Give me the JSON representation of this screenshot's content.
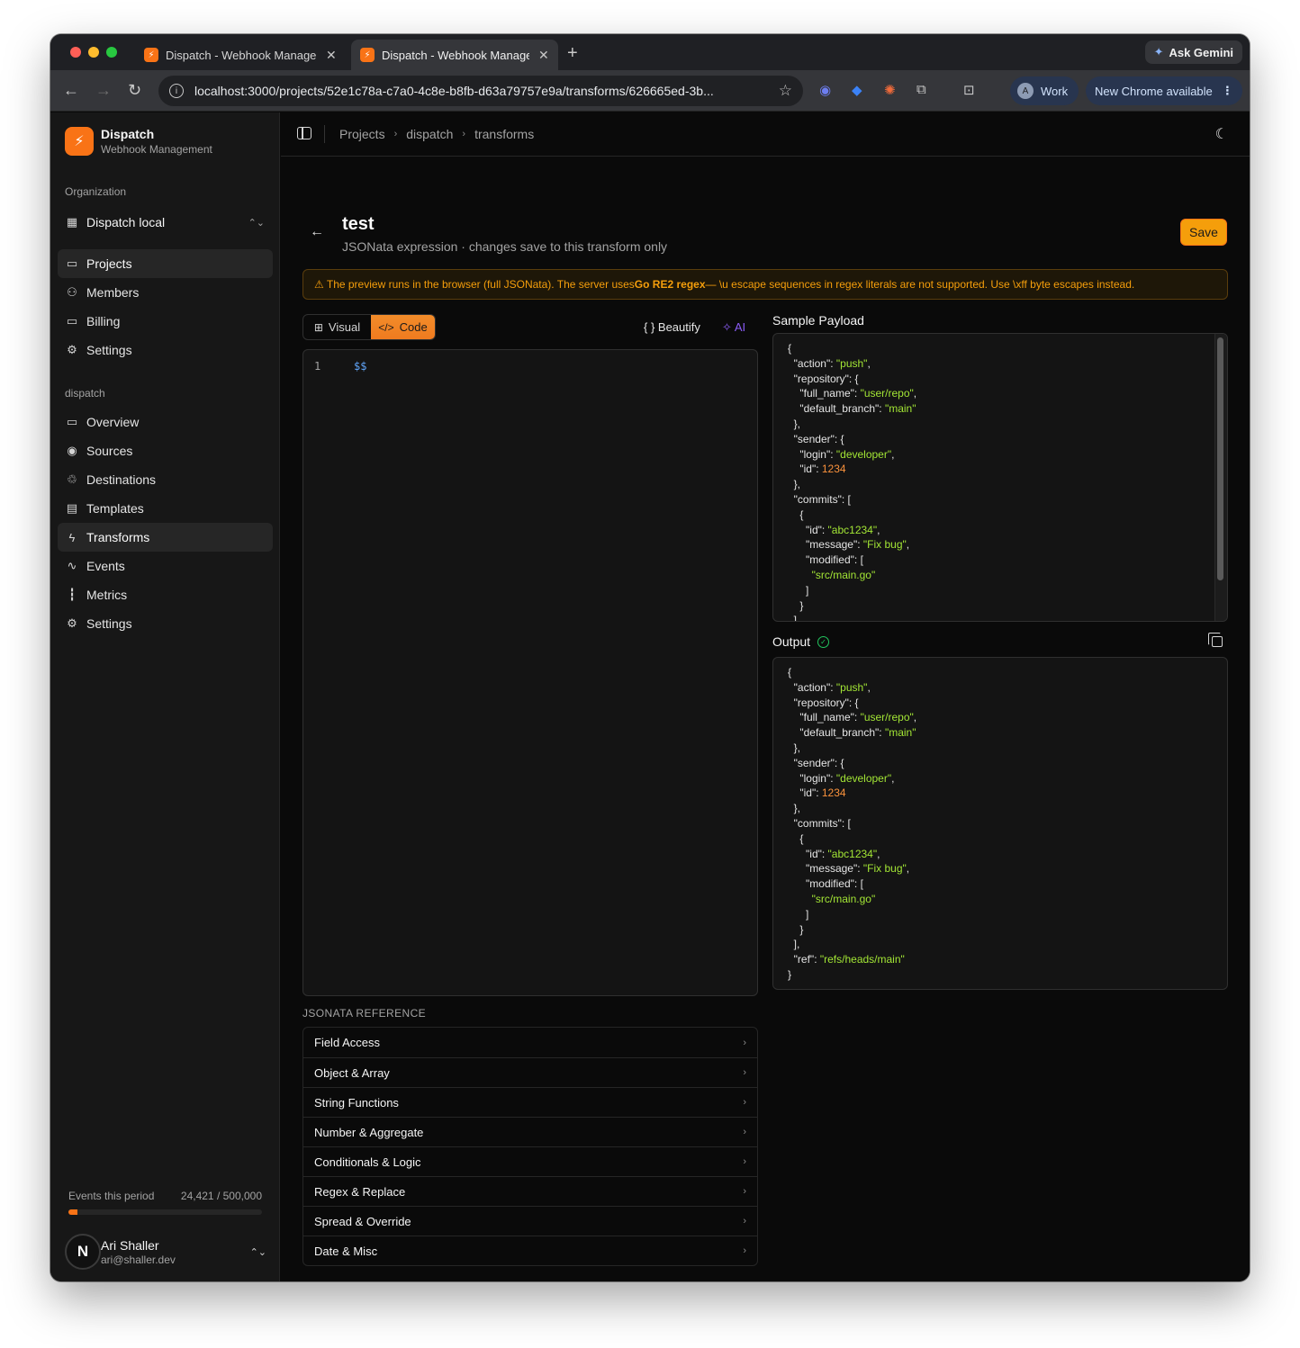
{
  "browser": {
    "tabs": [
      {
        "title": "Dispatch - Webhook Management",
        "active": false
      },
      {
        "title": "Dispatch - Webhook Management",
        "active": true
      }
    ],
    "ask_gemini": "Ask Gemini",
    "url": "localhost:3000/projects/52e1c78a-c7a0-4c8e-b8fb-d63a79757e9a/transforms/626665ed-3b...",
    "profile_label": "Work",
    "profile_initial": "A",
    "update_label": "New Chrome available"
  },
  "sidebar": {
    "brand_name": "Dispatch",
    "brand_sub": "Webhook Management",
    "org_label": "Organization",
    "org_name": "Dispatch local",
    "org_items": [
      {
        "label": "Projects",
        "icon": "folder-icon",
        "active": true
      },
      {
        "label": "Members",
        "icon": "users-icon",
        "active": false
      },
      {
        "label": "Billing",
        "icon": "credit-card-icon",
        "active": false
      },
      {
        "label": "Settings",
        "icon": "gear-icon",
        "active": false
      }
    ],
    "project_label": "dispatch",
    "project_items": [
      {
        "label": "Overview",
        "icon": "folder-open-icon",
        "active": false
      },
      {
        "label": "Sources",
        "icon": "broadcast-icon",
        "active": false
      },
      {
        "label": "Destinations",
        "icon": "webhook-icon",
        "active": false
      },
      {
        "label": "Templates",
        "icon": "file-text-icon",
        "active": false
      },
      {
        "label": "Transforms",
        "icon": "bolt-icon",
        "active": true
      },
      {
        "label": "Events",
        "icon": "activity-icon",
        "active": false
      },
      {
        "label": "Metrics",
        "icon": "bar-chart-icon",
        "active": false
      },
      {
        "label": "Settings",
        "icon": "gear-icon",
        "active": false
      }
    ],
    "usage_label": "Events this period",
    "usage_value": "24,421 / 500,000",
    "usage_fraction": 0.0488,
    "user_initial": "N",
    "user_name": "Ari Shaller",
    "user_email": "ari@shaller.dev"
  },
  "header": {
    "breadcrumbs": [
      "Projects",
      "dispatch",
      "transforms"
    ]
  },
  "page": {
    "title": "test",
    "subtitle": "JSONata expression · changes save to this transform only",
    "save_label": "Save",
    "warning_prefix": "⚠ The preview runs in the browser (full JSONata). The server uses ",
    "warning_bold": "Go RE2 regex",
    "warning_suffix": " — \\u escape sequences in regex literals are not supported. Use \\xff byte escapes instead.",
    "mode_visual": "Visual",
    "mode_code": "Code",
    "beautify_label": "{ } Beautify",
    "ai_label": "AI",
    "line_number": "1",
    "code": "$$",
    "reference_label": "JSONATA REFERENCE",
    "reference_items": [
      "Field Access",
      "Object & Array",
      "String Functions",
      "Number & Aggregate",
      "Conditionals & Logic",
      "Regex & Replace",
      "Spread & Override",
      "Date & Misc"
    ],
    "sample_label": "Sample Payload",
    "sample_json": "{\n  \"action\": \"push\",\n  \"repository\": {\n    \"full_name\": \"user/repo\",\n    \"default_branch\": \"main\"\n  },\n  \"sender\": {\n    \"login\": \"developer\",\n    \"id\": 1234\n  },\n  \"commits\": [\n    {\n      \"id\": \"abc1234\",\n      \"message\": \"Fix bug\",\n      \"modified\": [\n        \"src/main.go\"\n      ]\n    }\n  ]",
    "output_label": "Output",
    "output_json": "{\n  \"action\": \"push\",\n  \"repository\": {\n    \"full_name\": \"user/repo\",\n    \"default_branch\": \"main\"\n  },\n  \"sender\": {\n    \"login\": \"developer\",\n    \"id\": 1234\n  },\n  \"commits\": [\n    {\n      \"id\": \"abc1234\",\n      \"message\": \"Fix bug\",\n      \"modified\": [\n        \"src/main.go\"\n      ]\n    }\n  ],\n  \"ref\": \"refs/heads/main\"\n}"
  },
  "colors": {
    "accent": "#f97316",
    "string": "#a3e635",
    "number": "#fb923c",
    "key": "#e5e5e5"
  }
}
